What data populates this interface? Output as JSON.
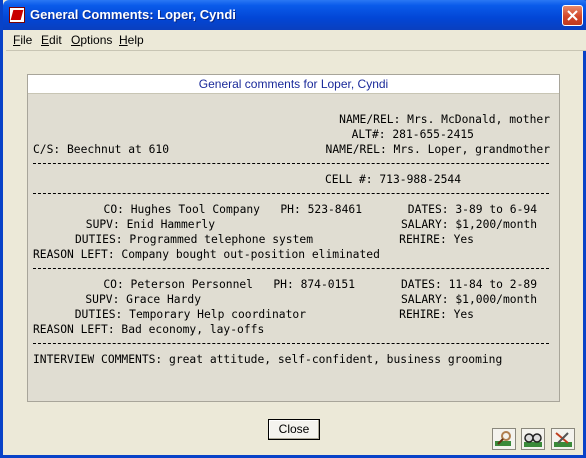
{
  "window": {
    "title": "General Comments:  Loper, Cyndi"
  },
  "menu": {
    "items": [
      {
        "mnemonic": "F",
        "rest": "ile"
      },
      {
        "mnemonic": "E",
        "rest": "dit"
      },
      {
        "mnemonic": "O",
        "rest": "ptions"
      },
      {
        "mnemonic": "H",
        "rest": "elp"
      }
    ]
  },
  "panel": {
    "header": "General comments for Loper, Cyndi",
    "lines": {
      "name_rel_1": "NAME/REL: Mrs. McDonald, mother",
      "alt": "ALT#: 281-655-2415",
      "cs": "C/S: Beechnut at 610",
      "name_rel_2": "NAME/REL: Mrs. Loper, grandmother",
      "cell": "CELL #: 713-988-2544",
      "job1_co": "CO: Hughes Tool Company   PH: 523-8461",
      "job1_dates": "DATES: 3-89 to 6-94",
      "job1_supv": "SUPV: Enid Hammerly",
      "job1_salary": "SALARY: $1,200/month",
      "job1_duties": "DUTIES: Programmed telephone system",
      "job1_rehire": "REHIRE: Yes",
      "job1_reason": "REASON LEFT: Company bought out-position eliminated",
      "job2_co": "CO: Peterson Personnel   PH: 874-0151",
      "job2_dates": "DATES: 11-84 to 2-89",
      "job2_supv": "SUPV: Grace Hardy",
      "job2_salary": "SALARY: $1,000/month",
      "job2_duties": "DUTIES: Temporary Help coordinator",
      "job2_rehire": "REHIRE: Yes",
      "job2_reason": "REASON LEFT: Bad economy, lay-offs",
      "interview": "INTERVIEW COMMENTS: great attitude, self-confident, business grooming"
    }
  },
  "buttons": {
    "close_label": "Close"
  },
  "toolbar_icons": [
    "hand-search-icon",
    "binoculars-icon",
    "tools-icon"
  ]
}
